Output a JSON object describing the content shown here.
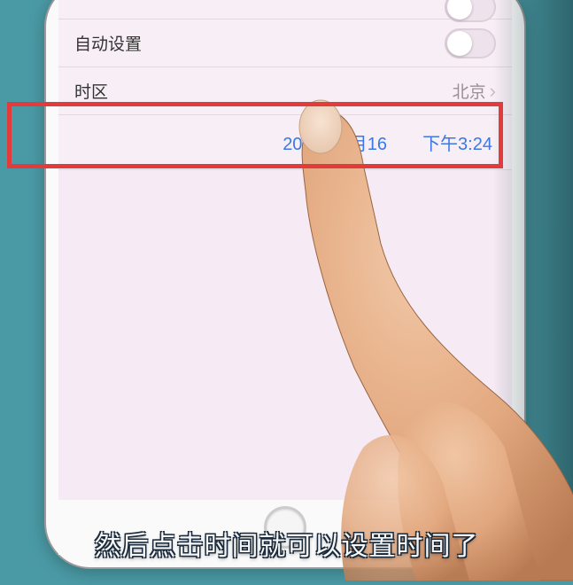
{
  "settings": {
    "auto_set_label": "自动设置",
    "timezone_label": "时区",
    "timezone_value": "北京",
    "date_value": "2018年5月16",
    "time_value": "下午3:24"
  },
  "caption": "然后点击时间就可以设置时间了"
}
